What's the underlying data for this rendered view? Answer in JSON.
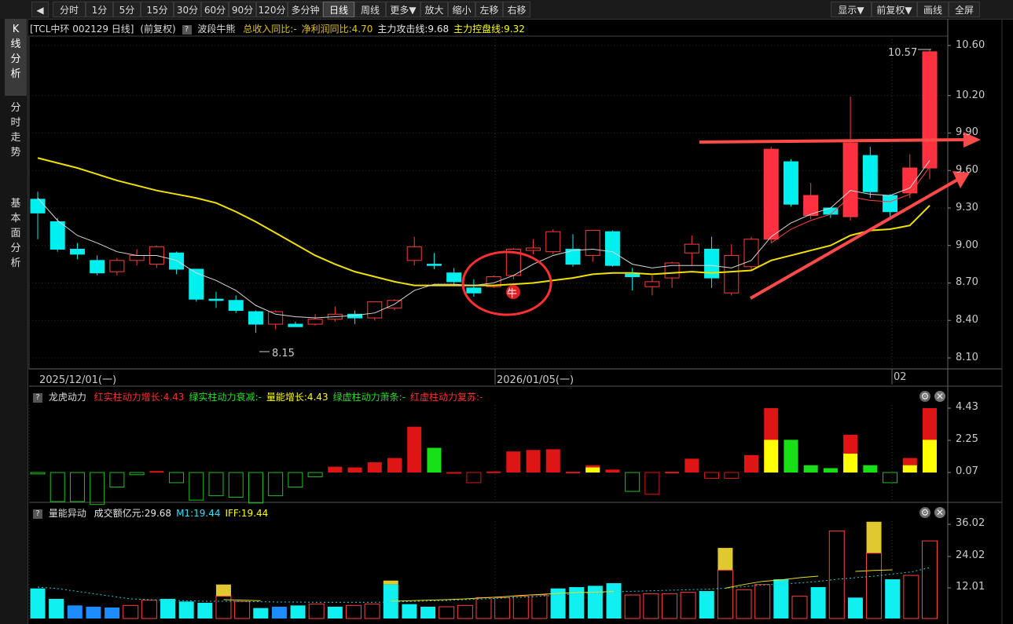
{
  "toolbar": {
    "periods": [
      "分时",
      "1分",
      "5分",
      "15分",
      "30分",
      "60分",
      "90分",
      "120分",
      "多分钟",
      "日线",
      "周线",
      "更多▼",
      "放大",
      "缩小",
      "左移",
      "右移"
    ],
    "active": "日线",
    "right": [
      "显示▼",
      "前复权▼",
      "画线",
      "全屏"
    ]
  },
  "sidebar": {
    "tabs": [
      {
        "label": "K线分析",
        "active": true
      },
      {
        "label": "分时走势",
        "active": false
      },
      {
        "label": "基本面分析",
        "active": false
      }
    ]
  },
  "main": {
    "title": "[TCL中环 002129 日线]",
    "fq": "(前复权)",
    "indicator": "波段牛熊",
    "legend": [
      {
        "text": "总收入同比:-",
        "color": "#e0c020"
      },
      {
        "text": "净利润同比:4.70",
        "color": "#e0c020"
      },
      {
        "text": "主力攻击线:9.68",
        "color": "#e8e8e8"
      },
      {
        "text": "主力控盘线:9.32",
        "color": "#ffff00"
      }
    ],
    "y_ticks": [
      "10.60",
      "10.20",
      "9.90",
      "9.60",
      "9.30",
      "9.00",
      "8.70",
      "8.40",
      "8.10"
    ],
    "dates": [
      "2025/12/01(一)",
      "2026/01/05(一)",
      "02"
    ],
    "low_label": "8.15",
    "high_label": "10.57",
    "bull_marker": "牛"
  },
  "lh": {
    "name": "龙虎动力",
    "legend": [
      {
        "text": "红实柱动力增长:4.43",
        "color": "#ff3030"
      },
      {
        "text": "绿实柱动力衰减:-",
        "color": "#20e020"
      },
      {
        "text": "量能增长:4.43",
        "color": "#ffff00"
      },
      {
        "text": "绿虚柱动力萧条:-",
        "color": "#20e020"
      },
      {
        "text": "红虚柱动力复苏:-",
        "color": "#ff3030"
      }
    ],
    "y_ticks": [
      "4.43",
      "2.25",
      "0.07"
    ]
  },
  "vol": {
    "name": "量能异动",
    "legend": [
      {
        "text": "成交额亿元:29.68",
        "color": "#e8e8e8"
      },
      {
        "text": "M1:19.44",
        "color": "#30e0ff"
      },
      {
        "text": "IFF:19.44",
        "color": "#ffff00"
      }
    ],
    "y_ticks": [
      "36.02",
      "24.02",
      "12.01"
    ]
  },
  "chart_data": {
    "type": "candlestick",
    "ylim": [
      8.1,
      10.6
    ],
    "candles": [
      {
        "o": 9.37,
        "h": 9.43,
        "l": 9.05,
        "c": 9.26,
        "up": false
      },
      {
        "o": 9.19,
        "h": 9.22,
        "l": 8.95,
        "c": 8.97,
        "up": false
      },
      {
        "o": 8.97,
        "h": 9.02,
        "l": 8.89,
        "c": 8.93,
        "up": false
      },
      {
        "o": 8.88,
        "h": 8.92,
        "l": 8.76,
        "c": 8.78,
        "up": false
      },
      {
        "o": 8.79,
        "h": 8.9,
        "l": 8.76,
        "c": 8.88,
        "up": true
      },
      {
        "o": 8.88,
        "h": 8.97,
        "l": 8.84,
        "c": 8.92,
        "up": true
      },
      {
        "o": 8.85,
        "h": 9.0,
        "l": 8.82,
        "c": 8.99,
        "up": true
      },
      {
        "o": 8.94,
        "h": 8.95,
        "l": 8.77,
        "c": 8.81,
        "up": false
      },
      {
        "o": 8.81,
        "h": 8.81,
        "l": 8.55,
        "c": 8.57,
        "up": false
      },
      {
        "o": 8.57,
        "h": 8.63,
        "l": 8.5,
        "c": 8.56,
        "up": false
      },
      {
        "o": 8.56,
        "h": 8.6,
        "l": 8.46,
        "c": 8.48,
        "up": false
      },
      {
        "o": 8.47,
        "h": 8.48,
        "l": 8.3,
        "c": 8.37,
        "up": false
      },
      {
        "o": 8.37,
        "h": 8.48,
        "l": 8.33,
        "c": 8.47,
        "up": true
      },
      {
        "o": 8.37,
        "h": 8.39,
        "l": 8.35,
        "c": 8.35,
        "up": false
      },
      {
        "o": 8.37,
        "h": 8.45,
        "l": 8.36,
        "c": 8.41,
        "up": true
      },
      {
        "o": 8.41,
        "h": 8.51,
        "l": 8.39,
        "c": 8.45,
        "up": true
      },
      {
        "o": 8.45,
        "h": 8.48,
        "l": 8.37,
        "c": 8.42,
        "up": false
      },
      {
        "o": 8.42,
        "h": 8.54,
        "l": 8.4,
        "c": 8.55,
        "up": true
      },
      {
        "o": 8.5,
        "h": 8.57,
        "l": 8.48,
        "c": 8.56,
        "up": true
      },
      {
        "o": 8.88,
        "h": 9.07,
        "l": 8.84,
        "c": 8.99,
        "up": true
      },
      {
        "o": 8.84,
        "h": 8.94,
        "l": 8.81,
        "c": 8.85,
        "up": false
      },
      {
        "o": 8.78,
        "h": 8.82,
        "l": 8.68,
        "c": 8.71,
        "up": false
      },
      {
        "o": 8.66,
        "h": 8.73,
        "l": 8.59,
        "c": 8.62,
        "up": false
      },
      {
        "o": 8.67,
        "h": 8.76,
        "l": 8.66,
        "c": 8.75,
        "up": true
      },
      {
        "o": 8.76,
        "h": 8.98,
        "l": 8.73,
        "c": 8.97,
        "up": true
      },
      {
        "o": 8.96,
        "h": 9.05,
        "l": 8.93,
        "c": 8.98,
        "up": true
      },
      {
        "o": 8.95,
        "h": 9.13,
        "l": 8.93,
        "c": 9.11,
        "up": true
      },
      {
        "o": 8.97,
        "h": 9.09,
        "l": 8.83,
        "c": 8.85,
        "up": false
      },
      {
        "o": 8.92,
        "h": 9.12,
        "l": 8.87,
        "c": 9.12,
        "up": true
      },
      {
        "o": 9.11,
        "h": 9.12,
        "l": 8.83,
        "c": 8.84,
        "up": false
      },
      {
        "o": 8.77,
        "h": 8.82,
        "l": 8.64,
        "c": 8.75,
        "up": false
      },
      {
        "o": 8.67,
        "h": 8.76,
        "l": 8.6,
        "c": 8.71,
        "up": true
      },
      {
        "o": 8.74,
        "h": 8.87,
        "l": 8.66,
        "c": 8.86,
        "up": true
      },
      {
        "o": 8.94,
        "h": 9.08,
        "l": 8.84,
        "c": 9.01,
        "up": true
      },
      {
        "o": 8.97,
        "h": 9.07,
        "l": 8.66,
        "c": 8.74,
        "up": false
      },
      {
        "o": 8.62,
        "h": 9.01,
        "l": 8.6,
        "c": 8.92,
        "up": true
      },
      {
        "o": 8.83,
        "h": 9.07,
        "l": 8.8,
        "c": 9.05,
        "up": true
      },
      {
        "o": 9.05,
        "h": 9.79,
        "l": 9.02,
        "c": 9.77,
        "up": true
      },
      {
        "o": 9.67,
        "h": 9.69,
        "l": 9.31,
        "c": 9.33,
        "up": false
      },
      {
        "o": 9.24,
        "h": 9.5,
        "l": 9.21,
        "c": 9.4,
        "up": true
      },
      {
        "o": 9.3,
        "h": 9.3,
        "l": 9.22,
        "c": 9.25,
        "up": false
      },
      {
        "o": 9.23,
        "h": 10.19,
        "l": 9.2,
        "c": 9.82,
        "up": true
      },
      {
        "o": 9.72,
        "h": 9.79,
        "l": 9.38,
        "c": 9.43,
        "up": false
      },
      {
        "o": 9.4,
        "h": 9.41,
        "l": 9.23,
        "c": 9.27,
        "up": false
      },
      {
        "o": 9.42,
        "h": 9.73,
        "l": 9.38,
        "c": 9.62,
        "up": true
      },
      {
        "o": 9.62,
        "h": 10.57,
        "l": 9.53,
        "c": 10.55,
        "up": true
      }
    ],
    "yellow_line": [
      9.7,
      9.66,
      9.62,
      9.57,
      9.52,
      9.48,
      9.44,
      9.41,
      9.38,
      9.34,
      9.27,
      9.19,
      9.1,
      9.01,
      8.92,
      8.85,
      8.79,
      8.75,
      8.71,
      8.68,
      8.68,
      8.68,
      8.68,
      8.68,
      8.69,
      8.7,
      8.72,
      8.74,
      8.77,
      8.78,
      8.78,
      8.77,
      8.78,
      8.79,
      8.78,
      8.79,
      8.8,
      8.88,
      8.92,
      8.96,
      9.0,
      9.08,
      9.12,
      9.13,
      9.16,
      9.32
    ],
    "white_line": [
      9.38,
      9.2,
      9.08,
      9.02,
      8.95,
      8.92,
      8.92,
      8.88,
      8.78,
      8.72,
      8.64,
      8.52,
      8.45,
      8.43,
      8.42,
      8.43,
      8.44,
      8.46,
      8.53,
      8.64,
      8.69,
      8.69,
      8.68,
      8.7,
      8.76,
      8.85,
      8.92,
      8.96,
      8.97,
      8.95,
      8.85,
      8.82,
      8.84,
      8.84,
      8.84,
      8.82,
      8.88,
      9.07,
      9.18,
      9.25,
      9.3,
      9.44,
      9.41,
      9.4,
      9.46,
      9.68
    ],
    "lh_values": [
      -0.1,
      -2.0,
      -2.0,
      -2.2,
      -1.0,
      -0.15,
      0.1,
      -0.7,
      -1.9,
      -1.6,
      -1.7,
      -2.1,
      -1.6,
      -1.0,
      -0.3,
      0.4,
      0.35,
      0.7,
      1.0,
      3.15,
      1.7,
      -0.05,
      -0.7,
      0.07,
      1.45,
      1.55,
      1.6,
      0.05,
      0.5,
      0.2,
      -1.3,
      -1.5,
      0.05,
      0.95,
      -0.4,
      -0.4,
      1.2,
      4.43,
      2.25,
      0.5,
      0.3,
      2.6,
      0.5,
      -0.7,
      1.0,
      4.43
    ],
    "lh_yellow": [
      0,
      0,
      0,
      0,
      0,
      0,
      0,
      0,
      0,
      0,
      0,
      0,
      0,
      0,
      0,
      0,
      0,
      0,
      0,
      0,
      0,
      0,
      0,
      0,
      0,
      0,
      0,
      0,
      0.35,
      0,
      0,
      0,
      0,
      0,
      0,
      0,
      0,
      2.25,
      0,
      0,
      0,
      1.3,
      0,
      0,
      0.5,
      2.25
    ],
    "vol_values": [
      11.5,
      7.5,
      5.0,
      4.5,
      4.2,
      5.0,
      7.0,
      7.5,
      6.5,
      6.0,
      8.5,
      6.5,
      4.0,
      4.5,
      5.0,
      5.5,
      4.5,
      5.0,
      5.5,
      13.0,
      5.5,
      4.5,
      4.5,
      5.0,
      8.0,
      8.0,
      8.5,
      9.0,
      11.5,
      12.0,
      12.5,
      13.5,
      9.0,
      9.5,
      9.5,
      10.0,
      10.5,
      18.5,
      11.0,
      13.0,
      15.0,
      8.5,
      12.0,
      33.5,
      8.0,
      25.0,
      15.0,
      16.5,
      29.68
    ],
    "vol_yellow": [
      0,
      0,
      0,
      0,
      0,
      0,
      0,
      0,
      0,
      0,
      13.0,
      0,
      0,
      0,
      0,
      0,
      0,
      0,
      0,
      14.5,
      0,
      0,
      0,
      0,
      0,
      0,
      0,
      0,
      0,
      0,
      0,
      0,
      0,
      0,
      0,
      0,
      0,
      27.0,
      0,
      0,
      0,
      0,
      0,
      0,
      0,
      37.0,
      0,
      0,
      0
    ]
  }
}
